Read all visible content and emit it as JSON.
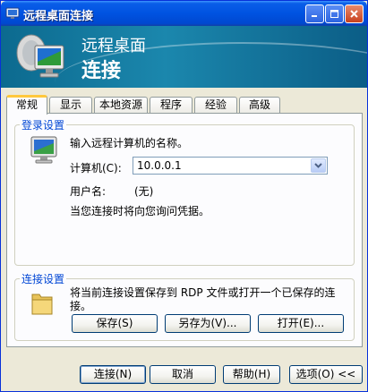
{
  "window": {
    "title": "远程桌面连接"
  },
  "banner": {
    "line1": "远程桌面",
    "line2": "连接"
  },
  "tabs": [
    {
      "label": "常规"
    },
    {
      "label": "显示"
    },
    {
      "label": "本地资源"
    },
    {
      "label": "程序"
    },
    {
      "label": "经验"
    },
    {
      "label": "高级"
    }
  ],
  "logon": {
    "group_label": "登录设置",
    "instruction": "输入远程计算机的名称。",
    "computer_label": "计算机(C):",
    "computer_value": "10.0.0.1",
    "username_label": "用户名:",
    "username_value": "(无)",
    "credentials_note": "当您连接时将向您询问凭据。"
  },
  "connection_settings": {
    "group_label": "连接设置",
    "description": "将当前连接设置保存到 RDP 文件或打开一个已保存的连接。",
    "save_label": "保存(S)",
    "save_as_label": "另存为(V)...",
    "open_label": "打开(E)..."
  },
  "footer": {
    "connect_label": "连接(N)",
    "cancel_label": "取消",
    "help_label": "帮助(H)",
    "options_label": "选项(O) <<"
  },
  "colors": {
    "accent": "#0046d5",
    "titlebar": "#0053e1",
    "banner": "#1b87ad"
  }
}
